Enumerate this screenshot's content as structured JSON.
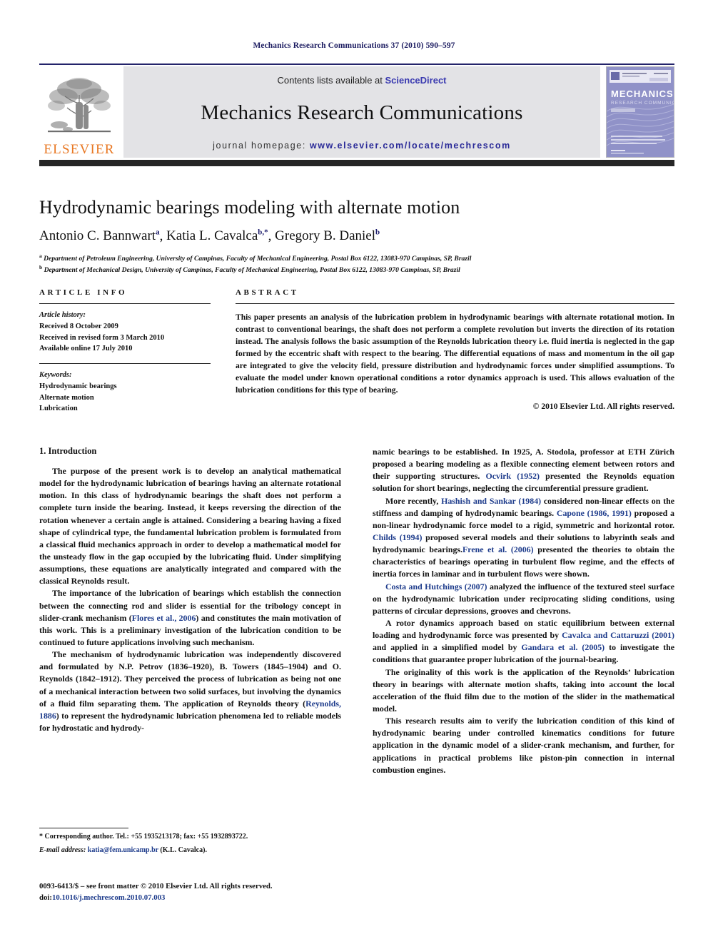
{
  "running_head": "Mechanics Research Communications 37 (2010) 590–597",
  "masthead": {
    "contents_prefix": "Contents lists available at",
    "sciencedirect": "ScienceDirect",
    "journal_title": "Mechanics Research Communications",
    "homepage_prefix": "journal homepage:",
    "homepage_url": "www.elsevier.com/locate/mechrescom",
    "publisher": "ELSEVIER",
    "cover_title_1": "MECHANICS",
    "cover_title_2": "RESEARCH COMMUNICATIONS",
    "cover_editor": "Editor: A. D. Rosato"
  },
  "colors": {
    "running_head": "#1b1b60",
    "link": "#1d3b8b",
    "sciencedirect": "#3a3ab0",
    "elsevier_orange": "#E87722",
    "masthead_band": "#e3e3e6",
    "rule_navy": "#23236a",
    "rule_dark": "#262626",
    "cover_purple": "#8e8fc4"
  },
  "title": "Hydrodynamic bearings modeling with alternate motion",
  "authors": [
    {
      "name": "Antonio C. Bannwart",
      "sup": "a"
    },
    {
      "name": "Katia L. Cavalca",
      "sup": "b,*"
    },
    {
      "name": "Gregory B. Daniel",
      "sup": "b"
    }
  ],
  "affiliations": [
    {
      "sup": "a",
      "text": "Department of Petroleum Engineering, University of Campinas, Faculty of Mechanical Engineering, Postal Box 6122, 13083-970 Campinas, SP, Brazil"
    },
    {
      "sup": "b",
      "text": "Department of Mechanical Design, University of Campinas, Faculty of Mechanical Engineering, Postal Box 6122, 13083-970 Campinas, SP, Brazil"
    }
  ],
  "article_info": {
    "heading": "ARTICLE INFO",
    "history_label": "Article history:",
    "history": [
      "Received 8 October 2009",
      "Received in revised form 3 March 2010",
      "Available online 17 July 2010"
    ],
    "keywords_label": "Keywords:",
    "keywords": [
      "Hydrodynamic bearings",
      "Alternate motion",
      "Lubrication"
    ]
  },
  "abstract": {
    "heading": "ABSTRACT",
    "text": "This paper presents an analysis of the lubrication problem in hydrodynamic bearings with alternate rotational motion. In contrast to conventional bearings, the shaft does not perform a complete revolution but inverts the direction of its rotation instead. The analysis follows the basic assumption of the Reynolds lubrication theory i.e. fluid inertia is neglected in the gap formed by the eccentric shaft with respect to the bearing. The differential equations of mass and momentum in the oil gap are integrated to give the velocity field, pressure distribution and hydrodynamic forces under simplified assumptions. To evaluate the model under known operational conditions a rotor dynamics approach is used. This allows evaluation of the lubrication conditions for this type of bearing.",
    "copyright": "© 2010 Elsevier Ltd. All rights reserved."
  },
  "section_heading": "1. Introduction",
  "left_column": {
    "p1": "The purpose of the present work is to develop an analytical mathematical model for the hydrodynamic lubrication of bearings having an alternate rotational motion. In this class of hydrodynamic bearings the shaft does not perform a complete turn inside the bearing. Instead, it keeps reversing the direction of the rotation whenever a certain angle is attained. Considering a bearing having a fixed shape of cylindrical type, the fundamental lubrication problem is formulated from a classical fluid mechanics approach in order to develop a mathematical model for the unsteady flow in the gap occupied by the lubricating fluid. Under simplifying assumptions, these equations are analytically integrated and compared with the classical Reynolds result.",
    "p2_a": "The importance of the lubrication of bearings which establish the connection between the connecting rod and slider is essential for the tribology concept in slider-crank mechanism (",
    "p2_ref": "Flores et al., 2006",
    "p2_b": ") and constitutes the main motivation of this work. This is a preliminary investigation of the lubrication condition to be continued to future applications involving such mechanism.",
    "p3_a": "The mechanism of hydrodynamic lubrication was independently discovered and formulated by N.P. Petrov (1836–1920), B. Towers (1845–1904) and O. Reynolds (1842–1912). They perceived the process of lubrication as being not one of a mechanical interaction between two solid surfaces, but involving the dynamics of a fluid film separating them. The application of Reynolds theory (",
    "p3_ref": "Reynolds, 1886",
    "p3_b": ") to represent the hydrodynamic lubrication phenomena led to reliable models for hydrostatic and hydrody-"
  },
  "right_column": {
    "p4_a": "namic bearings to be established. In 1925, A. Stodola, professor at ETH Zürich proposed a bearing modeling as a flexible connecting element between rotors and their supporting structures. ",
    "p4_ref": "Ocvirk (1952)",
    "p4_b": " presented the Reynolds equation solution for short bearings, neglecting the circumferential pressure gradient.",
    "p5_a": "More recently, ",
    "p5_ref1": "Hashish and Sankar (1984)",
    "p5_b": " considered non-linear effects on the stiffness and damping of hydrodynamic bearings. ",
    "p5_ref2": "Capone (1986, 1991)",
    "p5_c": " proposed a non-linear hydrodynamic force model to a rigid, symmetric and horizontal rotor. ",
    "p5_ref3": "Childs (1994)",
    "p5_d": " proposed several models and their solutions to labyrinth seals and hydrodynamic bearings.",
    "p5_ref4": "Frene et al. (2006)",
    "p5_e": " presented the theories to obtain the characteristics of bearings operating in turbulent flow regime, and the effects of inertia forces in laminar and in turbulent flows were shown.",
    "p6_ref": "Costa and Hutchings (2007)",
    "p6_a": " analyzed the influence of the textured steel surface on the hydrodynamic lubrication under reciprocating sliding conditions, using patterns of circular depressions, grooves and chevrons.",
    "p7_a": "A rotor dynamics approach based on static equilibrium between external loading and hydrodynamic force was presented by ",
    "p7_ref1": "Cavalca and Cattaruzzi (2001)",
    "p7_b": " and applied in a simplified model by ",
    "p7_ref2": "Gandara et al. (2005)",
    "p7_c": " to investigate the conditions that guarantee proper lubrication of the journal-bearing.",
    "p8": "The originality of this work is the application of the Reynolds’ lubrication theory in bearings with alternate motion shafts, taking into account the local acceleration of the fluid film due to the motion of the slider in the mathematical model.",
    "p9": "This research results aim to verify the lubrication condition of this kind of hydrodynamic bearing under controlled kinematics conditions for future application in the dynamic model of a slider-crank mechanism, and further, for applications in practical problems like piston-pin connection in internal combustion engines."
  },
  "footnotes": {
    "corresponding": "* Corresponding author. Tel.: +55 1935213178; fax: +55 1932893722.",
    "email_label": "E-mail address:",
    "email": "katia@fem.unicamp.br",
    "email_suffix": "(K.L. Cavalca).",
    "issn_line": "0093-6413/$ – see front matter © 2010 Elsevier Ltd. All rights reserved.",
    "doi_label": "doi:",
    "doi": "10.1016/j.mechrescom.2010.07.003"
  }
}
